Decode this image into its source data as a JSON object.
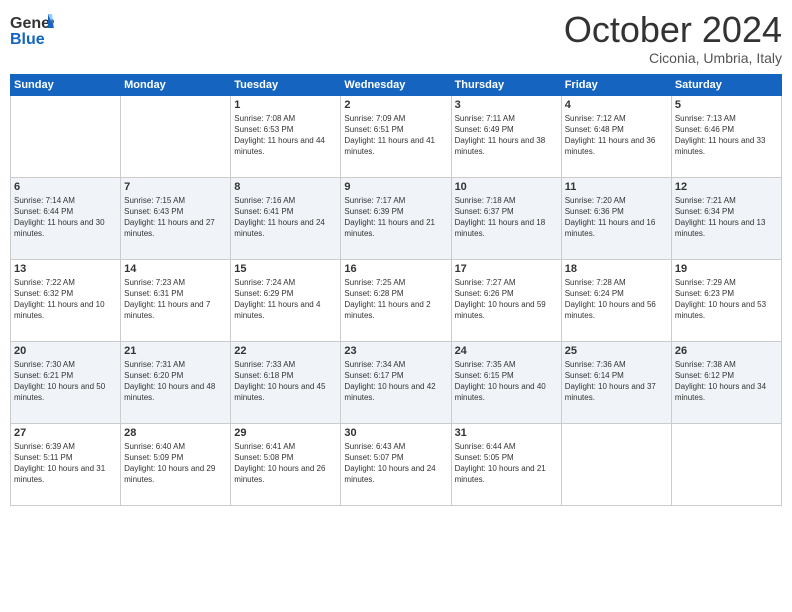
{
  "header": {
    "logo_general": "General",
    "logo_blue": "Blue",
    "month_title": "October 2024",
    "location": "Ciconia, Umbria, Italy"
  },
  "days_of_week": [
    "Sunday",
    "Monday",
    "Tuesday",
    "Wednesday",
    "Thursday",
    "Friday",
    "Saturday"
  ],
  "weeks": [
    [
      {
        "day": "",
        "info": ""
      },
      {
        "day": "",
        "info": ""
      },
      {
        "day": "1",
        "info": "Sunrise: 7:08 AM\nSunset: 6:53 PM\nDaylight: 11 hours and 44 minutes."
      },
      {
        "day": "2",
        "info": "Sunrise: 7:09 AM\nSunset: 6:51 PM\nDaylight: 11 hours and 41 minutes."
      },
      {
        "day": "3",
        "info": "Sunrise: 7:11 AM\nSunset: 6:49 PM\nDaylight: 11 hours and 38 minutes."
      },
      {
        "day": "4",
        "info": "Sunrise: 7:12 AM\nSunset: 6:48 PM\nDaylight: 11 hours and 36 minutes."
      },
      {
        "day": "5",
        "info": "Sunrise: 7:13 AM\nSunset: 6:46 PM\nDaylight: 11 hours and 33 minutes."
      }
    ],
    [
      {
        "day": "6",
        "info": "Sunrise: 7:14 AM\nSunset: 6:44 PM\nDaylight: 11 hours and 30 minutes."
      },
      {
        "day": "7",
        "info": "Sunrise: 7:15 AM\nSunset: 6:43 PM\nDaylight: 11 hours and 27 minutes."
      },
      {
        "day": "8",
        "info": "Sunrise: 7:16 AM\nSunset: 6:41 PM\nDaylight: 11 hours and 24 minutes."
      },
      {
        "day": "9",
        "info": "Sunrise: 7:17 AM\nSunset: 6:39 PM\nDaylight: 11 hours and 21 minutes."
      },
      {
        "day": "10",
        "info": "Sunrise: 7:18 AM\nSunset: 6:37 PM\nDaylight: 11 hours and 18 minutes."
      },
      {
        "day": "11",
        "info": "Sunrise: 7:20 AM\nSunset: 6:36 PM\nDaylight: 11 hours and 16 minutes."
      },
      {
        "day": "12",
        "info": "Sunrise: 7:21 AM\nSunset: 6:34 PM\nDaylight: 11 hours and 13 minutes."
      }
    ],
    [
      {
        "day": "13",
        "info": "Sunrise: 7:22 AM\nSunset: 6:32 PM\nDaylight: 11 hours and 10 minutes."
      },
      {
        "day": "14",
        "info": "Sunrise: 7:23 AM\nSunset: 6:31 PM\nDaylight: 11 hours and 7 minutes."
      },
      {
        "day": "15",
        "info": "Sunrise: 7:24 AM\nSunset: 6:29 PM\nDaylight: 11 hours and 4 minutes."
      },
      {
        "day": "16",
        "info": "Sunrise: 7:25 AM\nSunset: 6:28 PM\nDaylight: 11 hours and 2 minutes."
      },
      {
        "day": "17",
        "info": "Sunrise: 7:27 AM\nSunset: 6:26 PM\nDaylight: 10 hours and 59 minutes."
      },
      {
        "day": "18",
        "info": "Sunrise: 7:28 AM\nSunset: 6:24 PM\nDaylight: 10 hours and 56 minutes."
      },
      {
        "day": "19",
        "info": "Sunrise: 7:29 AM\nSunset: 6:23 PM\nDaylight: 10 hours and 53 minutes."
      }
    ],
    [
      {
        "day": "20",
        "info": "Sunrise: 7:30 AM\nSunset: 6:21 PM\nDaylight: 10 hours and 50 minutes."
      },
      {
        "day": "21",
        "info": "Sunrise: 7:31 AM\nSunset: 6:20 PM\nDaylight: 10 hours and 48 minutes."
      },
      {
        "day": "22",
        "info": "Sunrise: 7:33 AM\nSunset: 6:18 PM\nDaylight: 10 hours and 45 minutes."
      },
      {
        "day": "23",
        "info": "Sunrise: 7:34 AM\nSunset: 6:17 PM\nDaylight: 10 hours and 42 minutes."
      },
      {
        "day": "24",
        "info": "Sunrise: 7:35 AM\nSunset: 6:15 PM\nDaylight: 10 hours and 40 minutes."
      },
      {
        "day": "25",
        "info": "Sunrise: 7:36 AM\nSunset: 6:14 PM\nDaylight: 10 hours and 37 minutes."
      },
      {
        "day": "26",
        "info": "Sunrise: 7:38 AM\nSunset: 6:12 PM\nDaylight: 10 hours and 34 minutes."
      }
    ],
    [
      {
        "day": "27",
        "info": "Sunrise: 6:39 AM\nSunset: 5:11 PM\nDaylight: 10 hours and 31 minutes."
      },
      {
        "day": "28",
        "info": "Sunrise: 6:40 AM\nSunset: 5:09 PM\nDaylight: 10 hours and 29 minutes."
      },
      {
        "day": "29",
        "info": "Sunrise: 6:41 AM\nSunset: 5:08 PM\nDaylight: 10 hours and 26 minutes."
      },
      {
        "day": "30",
        "info": "Sunrise: 6:43 AM\nSunset: 5:07 PM\nDaylight: 10 hours and 24 minutes."
      },
      {
        "day": "31",
        "info": "Sunrise: 6:44 AM\nSunset: 5:05 PM\nDaylight: 10 hours and 21 minutes."
      },
      {
        "day": "",
        "info": ""
      },
      {
        "day": "",
        "info": ""
      }
    ]
  ]
}
